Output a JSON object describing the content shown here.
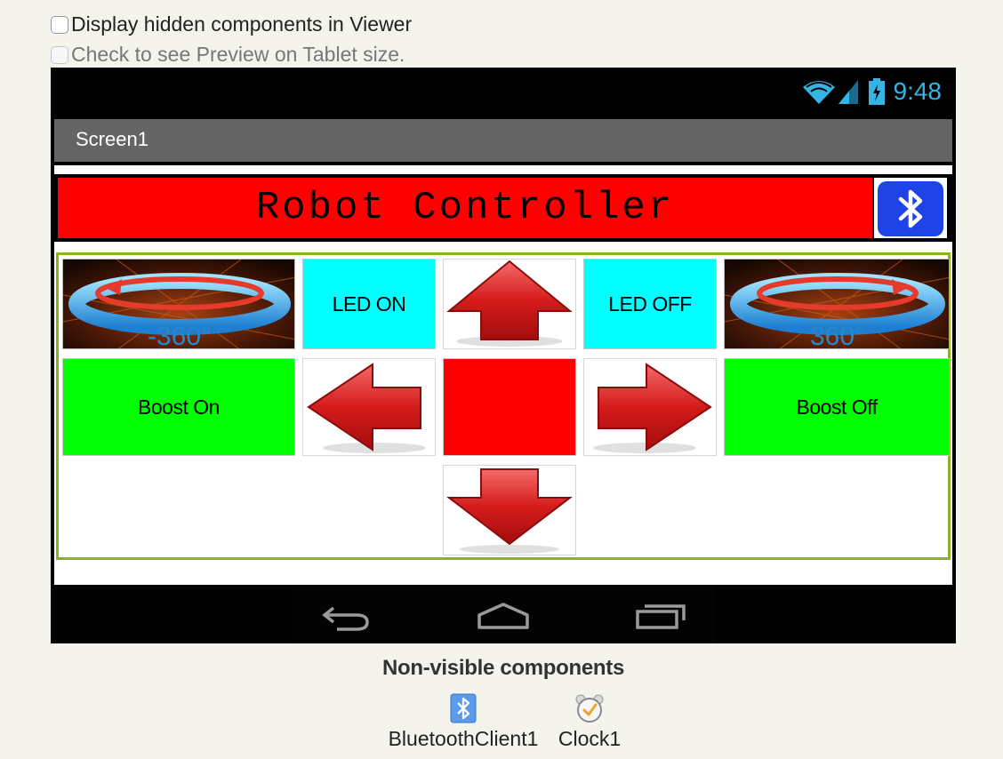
{
  "options": {
    "hidden_components_label": "Display hidden components in Viewer",
    "tablet_preview_label": "Check to see Preview on Tablet size."
  },
  "status_bar": {
    "time": "9:48",
    "icons": [
      "wifi-icon",
      "signal-icon",
      "battery-icon"
    ],
    "time_color": "#34b5e5"
  },
  "screen": {
    "title": "Screen1",
    "header": {
      "title": "Robot Controller",
      "background": "#ff0000",
      "bluetooth_button_color": "#1e44e8"
    },
    "controls": {
      "rotate_left_label": "-360°",
      "rotate_right_label": "360°",
      "led_on": "LED ON",
      "led_off": "LED OFF",
      "boost_on": "Boost On",
      "boost_off": "Boost Off",
      "colors": {
        "led": "#00ffff",
        "boost": "#00ff00",
        "stop": "#ff0000",
        "border": "#8ab41f"
      }
    }
  },
  "nav_bar": {
    "icons": [
      "back-icon",
      "home-icon",
      "recent-apps-icon"
    ]
  },
  "non_visible": {
    "title": "Non-visible components",
    "components": [
      {
        "label": "BluetoothClient1",
        "icon": "bluetooth-icon"
      },
      {
        "label": "Clock1",
        "icon": "clock-icon"
      }
    ]
  }
}
